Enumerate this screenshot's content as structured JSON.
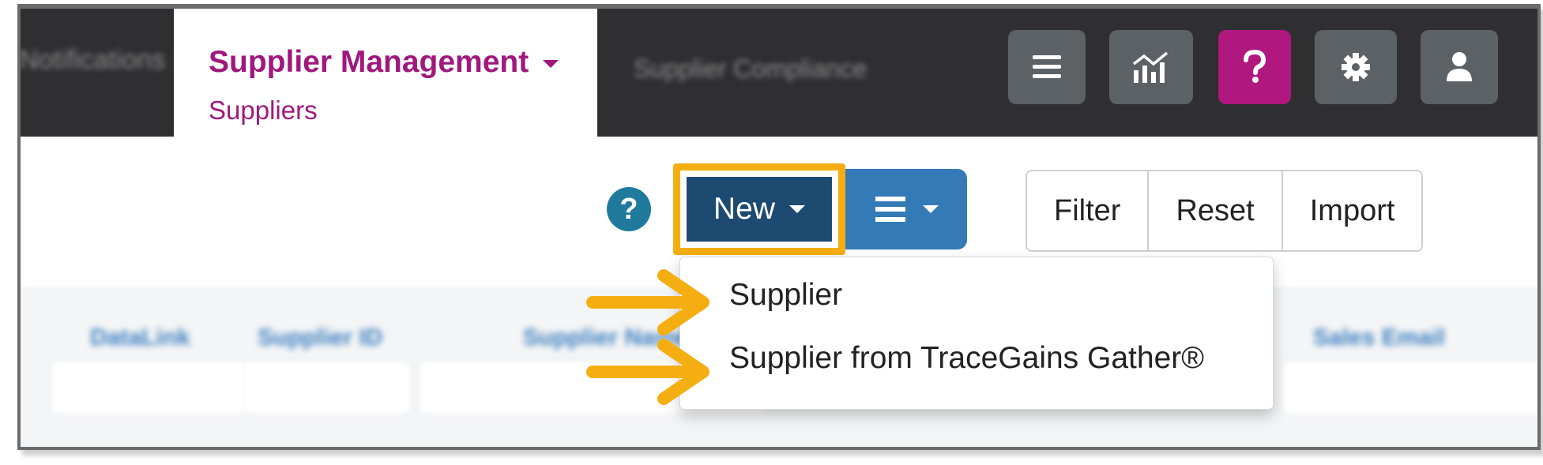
{
  "nav": {
    "left_tab_label": "Notifications",
    "active_tab": {
      "title": "Supplier Management",
      "subtitle": "Suppliers"
    },
    "next_tab_label": "Supplier Compliance",
    "icons": [
      "menu-icon",
      "reports-icon",
      "help-icon",
      "gear-icon",
      "user-icon"
    ]
  },
  "toolbar": {
    "help_glyph": "?",
    "new_label": "New",
    "filter_label": "Filter",
    "reset_label": "Reset",
    "import_label": "Import"
  },
  "new_menu": {
    "items": [
      {
        "label": "Supplier"
      },
      {
        "label": "Supplier from TraceGains Gather®"
      }
    ]
  },
  "grid": {
    "columns": [
      "DataLink",
      "Supplier ID",
      "Supplier Name",
      "Sales Email"
    ]
  },
  "colors": {
    "nav_bg": "#2f2f31",
    "brand_magenta": "#a0187e",
    "new_button": "#1d4a70",
    "menu_button": "#337ab7",
    "highlight": "#f5ae12"
  }
}
